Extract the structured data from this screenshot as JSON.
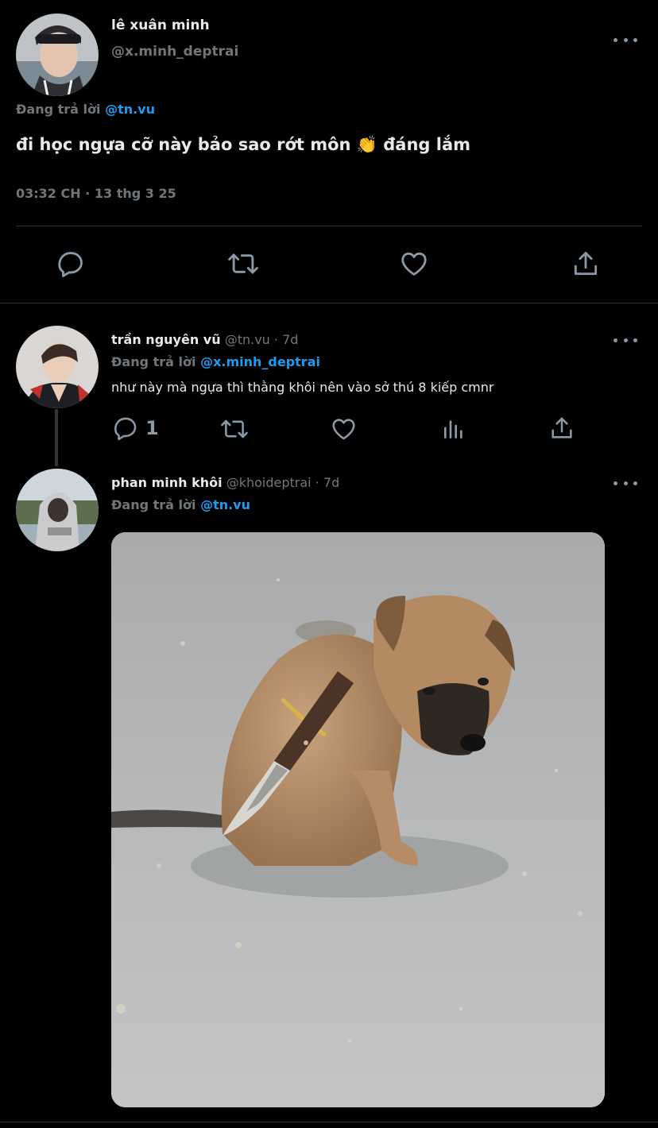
{
  "main_tweet": {
    "name": "lê xuân minh",
    "handle": "@x.minh_deptrai",
    "reply_prefix": "Đang trả lời",
    "reply_to": "@tn.vu",
    "text": "đi học ngựa cỡ này bảo sao rớt môn 👏  đáng lắm",
    "timestamp": "03:32 CH · 13 thg 3 25"
  },
  "replies": [
    {
      "name": "trần nguyên vũ",
      "handle": "@tn.vu",
      "age": "· 7d",
      "reply_prefix": "Đang trả lời",
      "reply_to": "@x.minh_deptrai",
      "text": "như này mà ngựa thì thằng khôi nên vào sở thú 8 kiếp cmnr",
      "reply_count": "1"
    },
    {
      "name": "phan minh khôi",
      "handle": "@khoideptrai",
      "age": "· 7d",
      "reply_prefix": "Đang trả lời",
      "reply_to": "@tn.vu"
    }
  ],
  "icons": {
    "reply": "reply-icon",
    "retweet": "retweet-icon",
    "like": "heart-icon",
    "share": "share-icon",
    "views": "analytics-icon",
    "more": "more-icon"
  },
  "colors": {
    "background": "#000000",
    "text": "#e7e9ea",
    "muted": "#71767b",
    "link": "#1d9bf0",
    "divider": "#2f3336"
  }
}
